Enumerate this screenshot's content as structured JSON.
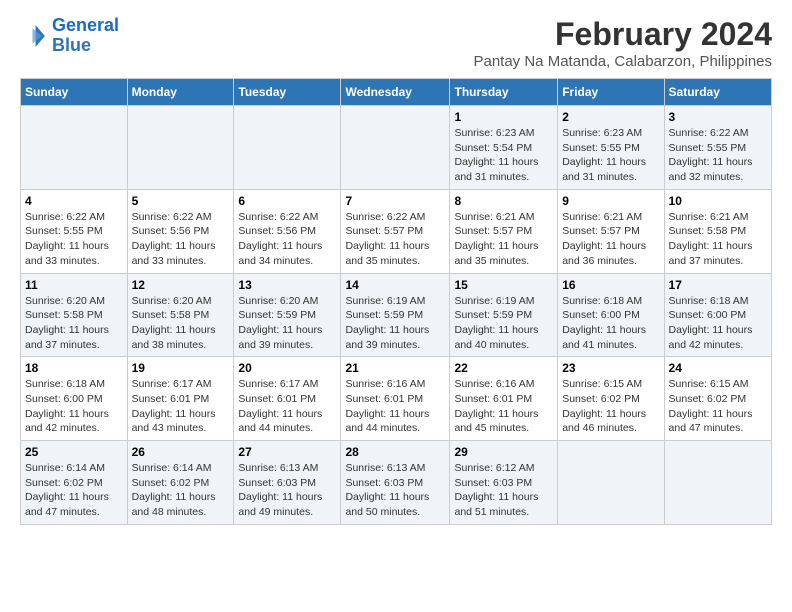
{
  "logo": {
    "line1": "General",
    "line2": "Blue"
  },
  "title": "February 2024",
  "subtitle": "Pantay Na Matanda, Calabarzon, Philippines",
  "days_of_week": [
    "Sunday",
    "Monday",
    "Tuesday",
    "Wednesday",
    "Thursday",
    "Friday",
    "Saturday"
  ],
  "weeks": [
    [
      {
        "day": "",
        "sunrise": "",
        "sunset": "",
        "daylight": ""
      },
      {
        "day": "",
        "sunrise": "",
        "sunset": "",
        "daylight": ""
      },
      {
        "day": "",
        "sunrise": "",
        "sunset": "",
        "daylight": ""
      },
      {
        "day": "",
        "sunrise": "",
        "sunset": "",
        "daylight": ""
      },
      {
        "day": "1",
        "sunrise": "Sunrise: 6:23 AM",
        "sunset": "Sunset: 5:54 PM",
        "daylight": "Daylight: 11 hours and 31 minutes."
      },
      {
        "day": "2",
        "sunrise": "Sunrise: 6:23 AM",
        "sunset": "Sunset: 5:55 PM",
        "daylight": "Daylight: 11 hours and 31 minutes."
      },
      {
        "day": "3",
        "sunrise": "Sunrise: 6:22 AM",
        "sunset": "Sunset: 5:55 PM",
        "daylight": "Daylight: 11 hours and 32 minutes."
      }
    ],
    [
      {
        "day": "4",
        "sunrise": "Sunrise: 6:22 AM",
        "sunset": "Sunset: 5:55 PM",
        "daylight": "Daylight: 11 hours and 33 minutes."
      },
      {
        "day": "5",
        "sunrise": "Sunrise: 6:22 AM",
        "sunset": "Sunset: 5:56 PM",
        "daylight": "Daylight: 11 hours and 33 minutes."
      },
      {
        "day": "6",
        "sunrise": "Sunrise: 6:22 AM",
        "sunset": "Sunset: 5:56 PM",
        "daylight": "Daylight: 11 hours and 34 minutes."
      },
      {
        "day": "7",
        "sunrise": "Sunrise: 6:22 AM",
        "sunset": "Sunset: 5:57 PM",
        "daylight": "Daylight: 11 hours and 35 minutes."
      },
      {
        "day": "8",
        "sunrise": "Sunrise: 6:21 AM",
        "sunset": "Sunset: 5:57 PM",
        "daylight": "Daylight: 11 hours and 35 minutes."
      },
      {
        "day": "9",
        "sunrise": "Sunrise: 6:21 AM",
        "sunset": "Sunset: 5:57 PM",
        "daylight": "Daylight: 11 hours and 36 minutes."
      },
      {
        "day": "10",
        "sunrise": "Sunrise: 6:21 AM",
        "sunset": "Sunset: 5:58 PM",
        "daylight": "Daylight: 11 hours and 37 minutes."
      }
    ],
    [
      {
        "day": "11",
        "sunrise": "Sunrise: 6:20 AM",
        "sunset": "Sunset: 5:58 PM",
        "daylight": "Daylight: 11 hours and 37 minutes."
      },
      {
        "day": "12",
        "sunrise": "Sunrise: 6:20 AM",
        "sunset": "Sunset: 5:58 PM",
        "daylight": "Daylight: 11 hours and 38 minutes."
      },
      {
        "day": "13",
        "sunrise": "Sunrise: 6:20 AM",
        "sunset": "Sunset: 5:59 PM",
        "daylight": "Daylight: 11 hours and 39 minutes."
      },
      {
        "day": "14",
        "sunrise": "Sunrise: 6:19 AM",
        "sunset": "Sunset: 5:59 PM",
        "daylight": "Daylight: 11 hours and 39 minutes."
      },
      {
        "day": "15",
        "sunrise": "Sunrise: 6:19 AM",
        "sunset": "Sunset: 5:59 PM",
        "daylight": "Daylight: 11 hours and 40 minutes."
      },
      {
        "day": "16",
        "sunrise": "Sunrise: 6:18 AM",
        "sunset": "Sunset: 6:00 PM",
        "daylight": "Daylight: 11 hours and 41 minutes."
      },
      {
        "day": "17",
        "sunrise": "Sunrise: 6:18 AM",
        "sunset": "Sunset: 6:00 PM",
        "daylight": "Daylight: 11 hours and 42 minutes."
      }
    ],
    [
      {
        "day": "18",
        "sunrise": "Sunrise: 6:18 AM",
        "sunset": "Sunset: 6:00 PM",
        "daylight": "Daylight: 11 hours and 42 minutes."
      },
      {
        "day": "19",
        "sunrise": "Sunrise: 6:17 AM",
        "sunset": "Sunset: 6:01 PM",
        "daylight": "Daylight: 11 hours and 43 minutes."
      },
      {
        "day": "20",
        "sunrise": "Sunrise: 6:17 AM",
        "sunset": "Sunset: 6:01 PM",
        "daylight": "Daylight: 11 hours and 44 minutes."
      },
      {
        "day": "21",
        "sunrise": "Sunrise: 6:16 AM",
        "sunset": "Sunset: 6:01 PM",
        "daylight": "Daylight: 11 hours and 44 minutes."
      },
      {
        "day": "22",
        "sunrise": "Sunrise: 6:16 AM",
        "sunset": "Sunset: 6:01 PM",
        "daylight": "Daylight: 11 hours and 45 minutes."
      },
      {
        "day": "23",
        "sunrise": "Sunrise: 6:15 AM",
        "sunset": "Sunset: 6:02 PM",
        "daylight": "Daylight: 11 hours and 46 minutes."
      },
      {
        "day": "24",
        "sunrise": "Sunrise: 6:15 AM",
        "sunset": "Sunset: 6:02 PM",
        "daylight": "Daylight: 11 hours and 47 minutes."
      }
    ],
    [
      {
        "day": "25",
        "sunrise": "Sunrise: 6:14 AM",
        "sunset": "Sunset: 6:02 PM",
        "daylight": "Daylight: 11 hours and 47 minutes."
      },
      {
        "day": "26",
        "sunrise": "Sunrise: 6:14 AM",
        "sunset": "Sunset: 6:02 PM",
        "daylight": "Daylight: 11 hours and 48 minutes."
      },
      {
        "day": "27",
        "sunrise": "Sunrise: 6:13 AM",
        "sunset": "Sunset: 6:03 PM",
        "daylight": "Daylight: 11 hours and 49 minutes."
      },
      {
        "day": "28",
        "sunrise": "Sunrise: 6:13 AM",
        "sunset": "Sunset: 6:03 PM",
        "daylight": "Daylight: 11 hours and 50 minutes."
      },
      {
        "day": "29",
        "sunrise": "Sunrise: 6:12 AM",
        "sunset": "Sunset: 6:03 PM",
        "daylight": "Daylight: 11 hours and 51 minutes."
      },
      {
        "day": "",
        "sunrise": "",
        "sunset": "",
        "daylight": ""
      },
      {
        "day": "",
        "sunrise": "",
        "sunset": "",
        "daylight": ""
      }
    ]
  ]
}
